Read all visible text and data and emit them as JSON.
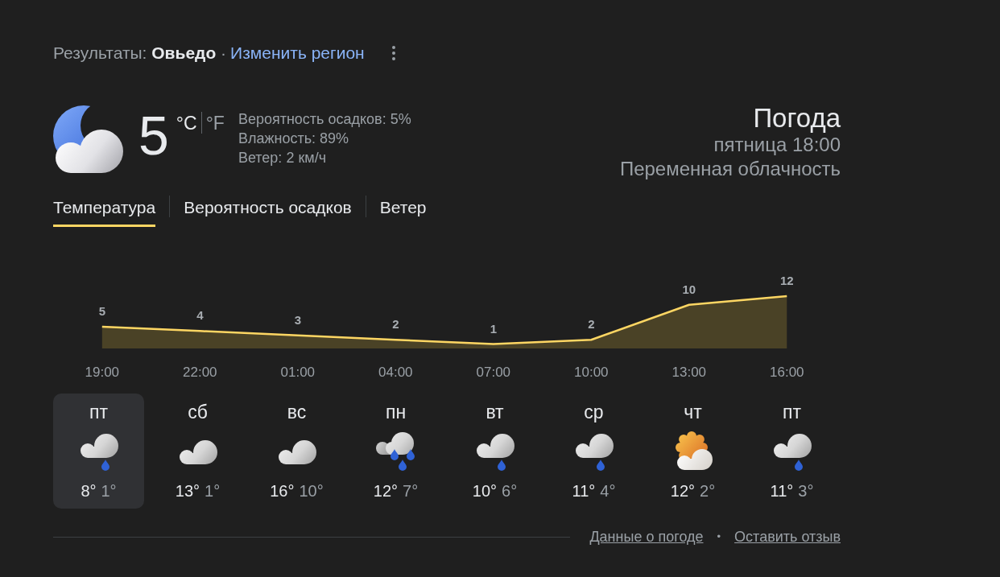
{
  "header": {
    "results": "Результаты: **Овьедо** ·",
    "change_region_link": "Изменить регион"
  },
  "current": {
    "temperature": "5",
    "units": [
      {
        "label": "°C",
        "selected": true
      },
      {
        "label": "°F",
        "selected": false
      }
    ],
    "details": [
      "Вероятность осадков: 5%",
      "Влажность: 89%",
      "Ветер: 2 км/ч"
    ],
    "title": "Погода",
    "date_time": "пятница 18:00",
    "condition": "Переменная облачность"
  },
  "tabs": [
    {
      "label": "Температура",
      "selected": true
    },
    {
      "label": "Вероятность осадков",
      "selected": false
    },
    {
      "label": "Ветер",
      "selected": false
    }
  ],
  "temperature_chart": {
    "chart_data": {
      "type": "area",
      "categories": [
        "19:00",
        "22:00",
        "01:00",
        "04:00",
        "07:00",
        "10:00",
        "13:00",
        "16:00"
      ],
      "values": [
        5,
        4,
        3,
        2,
        1,
        2,
        10,
        12
      ],
      "data_labels": true
    }
  },
  "days": [
    {
      "day": "пт",
      "kind": "rain",
      "high": "8°",
      "low": "1°",
      "selected": true
    },
    {
      "day": "сб",
      "kind": "cloudy",
      "high": "13°",
      "low": "1°",
      "selected": false
    },
    {
      "day": "вс",
      "kind": "cloudy",
      "high": "16°",
      "low": "10°",
      "selected": false
    },
    {
      "day": "пн",
      "kind": "heavy_rain",
      "high": "12°",
      "low": "7°",
      "selected": false
    },
    {
      "day": "вт",
      "kind": "rain",
      "high": "10°",
      "low": "6°",
      "selected": false
    },
    {
      "day": "ср",
      "kind": "rain",
      "high": "11°",
      "low": "4°",
      "selected": false
    },
    {
      "day": "чт",
      "kind": "sun_cloud",
      "high": "12°",
      "low": "2°",
      "selected": false
    },
    {
      "day": "пт",
      "kind": "rain",
      "high": "11°",
      "low": "3°",
      "selected": false
    }
  ],
  "footer": {
    "links": [
      "Данные о погоде",
      "Оставить отзыв"
    ],
    "separator": "•"
  }
}
